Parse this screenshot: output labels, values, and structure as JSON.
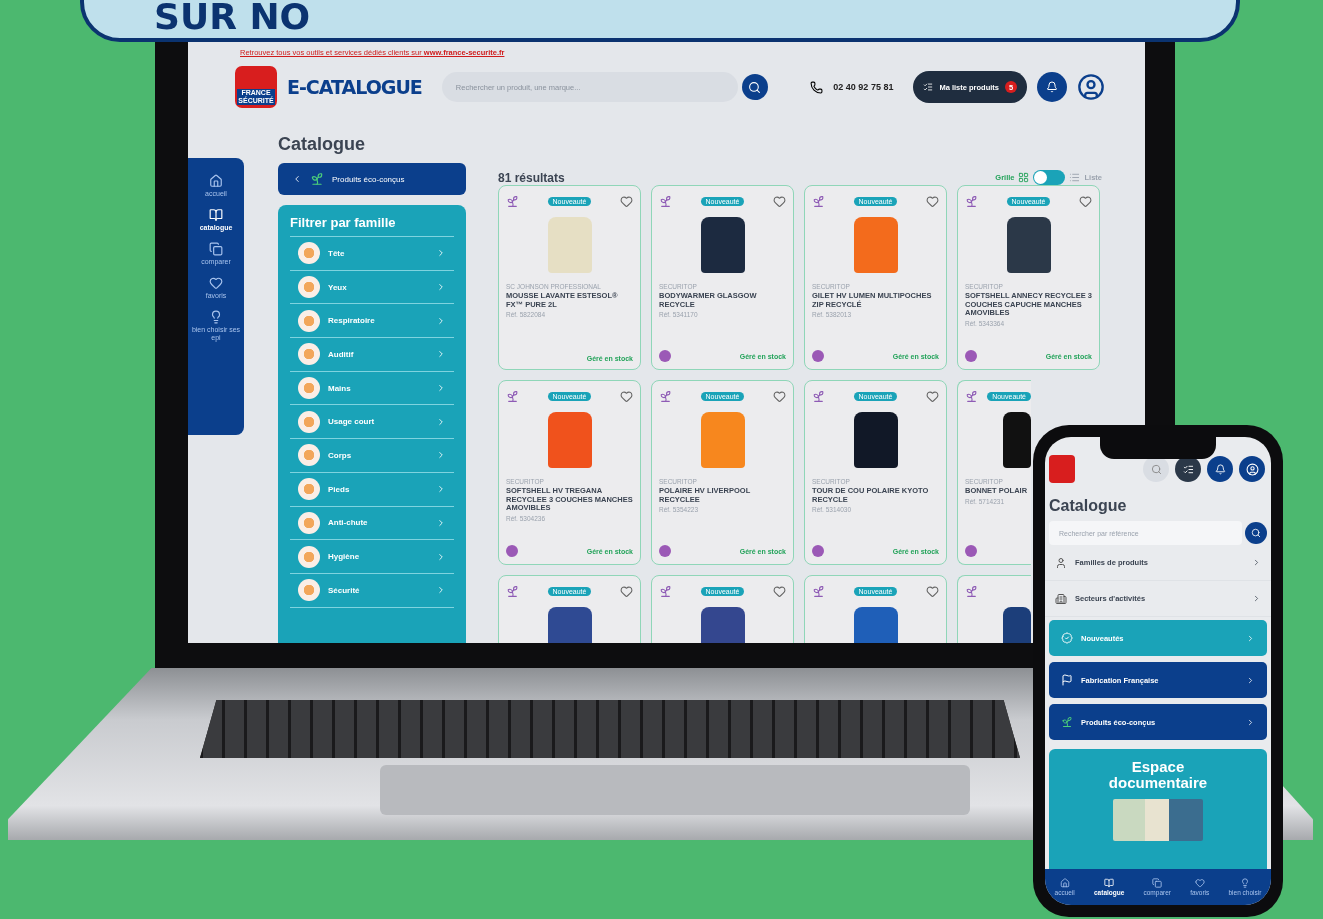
{
  "banner": {
    "text": "SUR NO"
  },
  "laptop": {
    "notice": {
      "text": "Retrouvez tous vos outils et services dédiés clients sur ",
      "link": "www.france-securite.fr"
    },
    "header": {
      "logo_text": "FRANCE SÉCURITÉ",
      "title": "E-CATALOGUE",
      "search_placeholder": "Rechercher un produit, une marque...",
      "phone": "02 40 92 75 81",
      "list_button": "Ma liste produits",
      "list_count": "5"
    },
    "nav": [
      {
        "label": "accueil",
        "selected": false
      },
      {
        "label": "catalogue",
        "selected": true
      },
      {
        "label": "comparer",
        "selected": false
      },
      {
        "label": "favoris",
        "selected": false
      },
      {
        "label": "bien choisir ses epi",
        "selected": false
      }
    ],
    "page_title": "Catalogue",
    "back_button": "Produits éco-conçus",
    "filter": {
      "title": "Filtrer par famille",
      "items": [
        "Tête",
        "Yeux",
        "Respiratoire",
        "Auditif",
        "Mains",
        "Usage court",
        "Corps",
        "Pieds",
        "Anti-chute",
        "Hygiène",
        "Sécurité"
      ]
    },
    "results": "81 résultats",
    "view": {
      "grid_label": "Grille",
      "list_label": "Liste",
      "grid_selected": true
    },
    "products": [
      {
        "badge": "Nouveauté",
        "brand": "SC JOHNSON PROFESSIONAL",
        "name": "MOUSSE LAVANTE ESTESOL® FX™ PURE 2L",
        "ref": "Réf. 5822084",
        "stock": "Géré en stock",
        "label": false,
        "color": "#e6dfc4"
      },
      {
        "badge": "Nouveauté",
        "brand": "SECURITOP",
        "name": "BODYWARMER GLASGOW RECYCLE",
        "ref": "Réf. 5341170",
        "stock": "Géré en stock",
        "label": true,
        "color": "#1c2a40"
      },
      {
        "badge": "Nouveauté",
        "brand": "SECURITOP",
        "name": "GILET HV LUMEN MULTIPOCHES ZIP RECYCLÉ",
        "ref": "Réf. 5382013",
        "stock": "Géré en stock",
        "label": true,
        "color": "#f36b1c"
      },
      {
        "badge": "Nouveauté",
        "brand": "SECURITOP",
        "name": "SOFTSHELL ANNECY RECYCLEE 3 COUCHES CAPUCHE MANCHES AMOVIBLES",
        "ref": "Réf. 5343364",
        "stock": "Géré en stock",
        "label": true,
        "color": "#2b3848"
      },
      {
        "badge": "Nouveauté",
        "brand": "SECURITOP",
        "name": "SOFTSHELL HV TREGANA RECYCLEE 3 COUCHES MANCHES AMOVIBLES",
        "ref": "Réf. 5304236",
        "stock": "Géré en stock",
        "label": true,
        "color": "#f0521c"
      },
      {
        "badge": "Nouveauté",
        "brand": "SECURITOP",
        "name": "POLAIRE HV LIVERPOOL RECYCLEE",
        "ref": "Réf. 5354223",
        "stock": "Géré en stock",
        "label": true,
        "color": "#f7871e"
      },
      {
        "badge": "Nouveauté",
        "brand": "SECURITOP",
        "name": "TOUR DE COU POLAIRE KYOTO RECYCLE",
        "ref": "Réf. 5314030",
        "stock": "Géré en stock",
        "label": true,
        "color": "#111827"
      },
      {
        "badge": "Nouveauté",
        "brand": "SECURITOP",
        "name": "BONNET POLAIR",
        "ref": "Réf. 5714231",
        "label": true,
        "color": "#111111"
      },
      {
        "badge": "Nouveauté",
        "color": "#2f4a93"
      },
      {
        "badge": "Nouveauté",
        "color": "#34478f"
      },
      {
        "badge": "Nouveauté",
        "color": "#1f5fb8"
      },
      {
        "color": "#1c3e7a"
      }
    ]
  },
  "phone": {
    "title": "Catalogue",
    "search_placeholder": "Rechercher par référence",
    "menu": [
      {
        "label": "Familles de produits",
        "kind": "plain"
      },
      {
        "label": "Secteurs d'activités",
        "kind": "plain"
      },
      {
        "label": "Nouveautés",
        "kind": "teal"
      },
      {
        "label": "Fabrication Française",
        "kind": "navy"
      },
      {
        "label": "Produits éco-conçus",
        "kind": "navy"
      }
    ],
    "promo": "Espace documentaire",
    "nav": [
      {
        "label": "accueil",
        "selected": false
      },
      {
        "label": "catalogue",
        "selected": true
      },
      {
        "label": "comparer",
        "selected": false
      },
      {
        "label": "favoris",
        "selected": false
      },
      {
        "label": "bien choisir",
        "selected": false
      }
    ]
  }
}
